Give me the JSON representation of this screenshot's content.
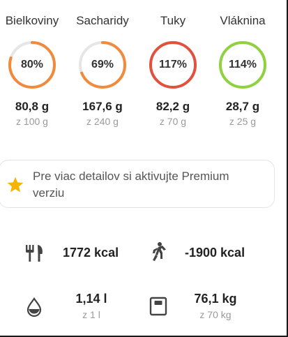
{
  "macros": [
    {
      "name": "Bielkoviny",
      "percent": "80%",
      "progress": 0.8,
      "value": "80,8 g",
      "target": "z 100 g",
      "color": "#f08a3c"
    },
    {
      "name": "Sacharidy",
      "percent": "69%",
      "progress": 0.69,
      "value": "167,6 g",
      "target": "z 240 g",
      "color": "#f08a3c"
    },
    {
      "name": "Tuky",
      "percent": "117%",
      "progress": 1.17,
      "value": "82,2 g",
      "target": "z 70 g",
      "color": "#e0523e"
    },
    {
      "name": "Vláknina",
      "percent": "114%",
      "progress": 1.14,
      "value": "28,7 g",
      "target": "z 25 g",
      "color": "#8fd13f"
    }
  ],
  "premium": {
    "text": "Pre viac detailov si aktivujte Premium verziu",
    "star_color": "#f5b400"
  },
  "stats": {
    "food": {
      "value": "1772 kcal",
      "icon": "fork-knife-icon"
    },
    "activity": {
      "value": "-1900 kcal",
      "icon": "walking-person-icon"
    },
    "water": {
      "value": "1,14 l",
      "target": "z 1 l",
      "icon": "water-drop-icon"
    },
    "weight": {
      "value": "76,1 kg",
      "target": "z 70 kg",
      "icon": "scale-icon"
    }
  },
  "colors": {
    "track": "#e6e6e6",
    "icon": "#444444"
  }
}
